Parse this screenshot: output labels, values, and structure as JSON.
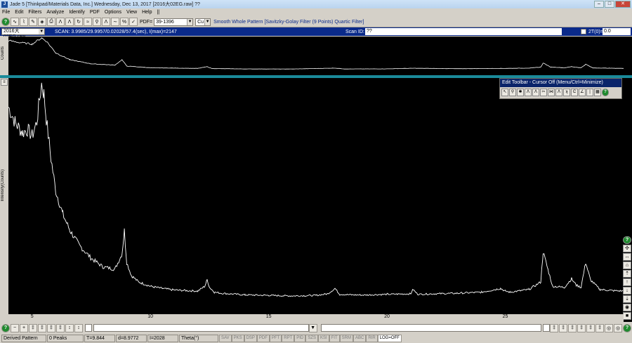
{
  "window": {
    "title": "Jade 5 [Thinkpad/Materials Data, Inc.] Wednesday, Dec 13, 2017 [2016大02EG.raw] ??",
    "icon": "jade-app-icon"
  },
  "menu": [
    "File",
    "Edit",
    "Filters",
    "Analyze",
    "Identify",
    "PDF",
    "Options",
    "View",
    "Help",
    "||"
  ],
  "toolbar": {
    "pdf_label": "PDF=",
    "pdf_value": "39-1396",
    "anode_value": "Cu",
    "smooth_text": "Smooth Whole Pattern [Savitzky-Golay Filter (9 Points) Quartic Filter]"
  },
  "scan": {
    "file": "2016大02EG.raw",
    "info": "SCAN: 3.9985/29.9957/0.02028/57.4(sec), I(max)=2147",
    "scan_id_label": "Scan ID:",
    "scan_id_value": "??",
    "theta_label": "2T(0)=",
    "theta_value": "0.0"
  },
  "overview": {
    "ylabel": "Counts"
  },
  "main": {
    "ylabel": "Intensity(Counts)"
  },
  "edit_toolbar": {
    "title": "Edit Toolbar - Cursor Off (Menu/Ctrl=Minimize)"
  },
  "chart_data": {
    "type": "line",
    "title": "",
    "xlabel": "",
    "ylabel": "Intensity(Counts)",
    "xlim": [
      4.0,
      30.0
    ],
    "ylim": [
      0,
      2147
    ],
    "grid": false,
    "line_color": "#ffffff",
    "background": "#000000",
    "x_ticks": [
      5,
      10,
      15,
      20,
      25
    ],
    "series": [
      {
        "name": "",
        "x": [
          4.0,
          4.3,
          4.6,
          4.8,
          5.0,
          5.2,
          5.4,
          5.5,
          5.6,
          5.8,
          6.0,
          6.3,
          6.6,
          7.0,
          7.5,
          8.0,
          8.5,
          8.8,
          8.9,
          9.0,
          9.2,
          9.5,
          10.0,
          10.5,
          11.0,
          11.5,
          12.0,
          12.3,
          12.4,
          12.5,
          12.7,
          13.0,
          14.0,
          15.0,
          16.0,
          17.0,
          17.5,
          17.8,
          18.0,
          18.5,
          19.0,
          20.0,
          21.0,
          21.1,
          21.3,
          22.0,
          23.0,
          24.0,
          24.8,
          25.0,
          25.2,
          26.0,
          26.5,
          26.6,
          26.8,
          27.0,
          27.5,
          27.8,
          28.0,
          28.2,
          28.4,
          28.6,
          29.0,
          29.5,
          30.0
        ],
        "values": [
          1930,
          1780,
          1690,
          1720,
          1660,
          1790,
          2147,
          2050,
          1820,
          1450,
          1150,
          930,
          780,
          640,
          520,
          440,
          420,
          560,
          780,
          480,
          360,
          300,
          260,
          240,
          225,
          220,
          215,
          260,
          320,
          250,
          205,
          195,
          180,
          175,
          170,
          175,
          190,
          240,
          185,
          180,
          178,
          185,
          190,
          230,
          185,
          190,
          195,
          205,
          240,
          215,
          205,
          230,
          300,
          580,
          420,
          260,
          250,
          330,
          270,
          250,
          480,
          320,
          230,
          220,
          215
        ]
      }
    ],
    "overview_series": {
      "x": [
        4.0,
        4.5,
        5.0,
        5.4,
        5.6,
        6.0,
        6.6,
        7.5,
        8.5,
        8.8,
        9.0,
        10.0,
        12.0,
        12.4,
        12.6,
        14.0,
        16.0,
        17.8,
        18.2,
        20.0,
        21.1,
        23.0,
        25.0,
        26.0,
        26.5,
        26.6,
        26.9,
        27.5,
        27.8,
        28.2,
        28.4,
        28.7,
        30.0
      ],
      "values": [
        1980,
        1850,
        1760,
        2147,
        1950,
        1200,
        760,
        500,
        420,
        760,
        360,
        250,
        210,
        320,
        200,
        175,
        170,
        230,
        175,
        180,
        220,
        190,
        210,
        230,
        290,
        560,
        300,
        250,
        320,
        250,
        470,
        240,
        210
      ]
    }
  }
}
